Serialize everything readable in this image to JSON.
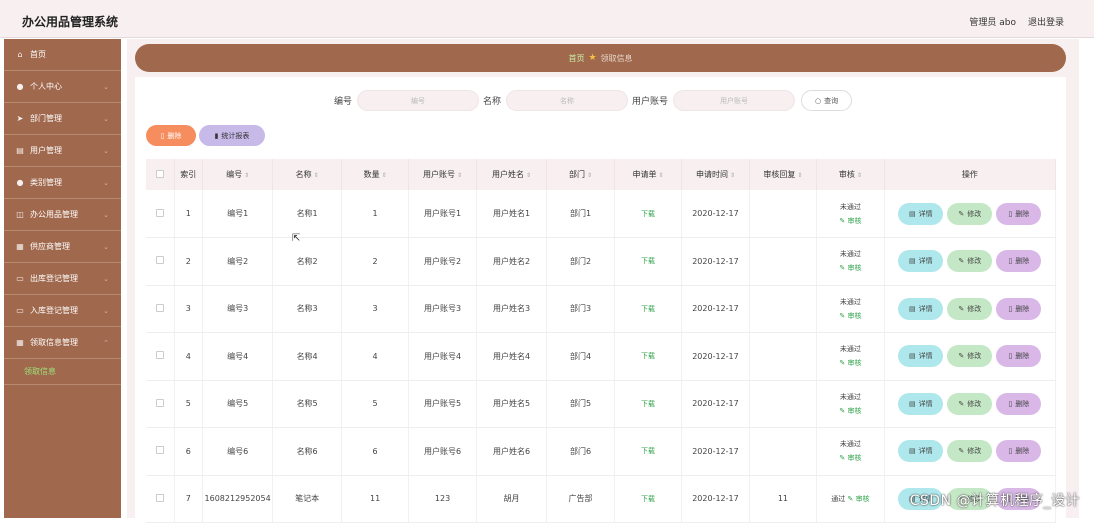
{
  "app": {
    "title": "办公用品管理系统"
  },
  "header": {
    "user": "管理员 abo",
    "logout": "退出登录"
  },
  "sidebar": {
    "items": [
      {
        "icon": "⌂",
        "label": "首页",
        "chev": ""
      },
      {
        "icon": "●",
        "label": "个人中心",
        "chev": "⌄"
      },
      {
        "icon": "➤",
        "label": "部门管理",
        "chev": "⌄"
      },
      {
        "icon": "▤",
        "label": "用户管理",
        "chev": "⌄"
      },
      {
        "icon": "●",
        "label": "类别管理",
        "chev": "⌄"
      },
      {
        "icon": "◫",
        "label": "办公用品管理",
        "chev": "⌄"
      },
      {
        "icon": "▦",
        "label": "供应商管理",
        "chev": "⌄"
      },
      {
        "icon": "▭",
        "label": "出库登记管理",
        "chev": "⌄"
      },
      {
        "icon": "▭",
        "label": "入库登记管理",
        "chev": "⌄"
      },
      {
        "icon": "▦",
        "label": "领取信息管理",
        "chev": "⌃"
      }
    ],
    "sub_item": "领取信息"
  },
  "breadcrumb": {
    "home": "首页",
    "star": "★",
    "current": "领取信息"
  },
  "search": {
    "f1_label": "编号",
    "f1_placeholder": "编号",
    "f2_label": "名称",
    "f2_placeholder": "名称",
    "f3_label": "用户账号",
    "f3_placeholder": "用户账号",
    "query": "查询"
  },
  "actions": {
    "delete": "删除",
    "stats": "统计报表"
  },
  "table": {
    "headers": [
      "索引",
      "编号",
      "名称",
      "数量",
      "用户账号",
      "用户姓名",
      "部门",
      "申请单",
      "申请时间",
      "审核回复",
      "审核",
      "操作"
    ],
    "rows": [
      [
        "1",
        "编号1",
        "名称1",
        "1",
        "用户账号1",
        "用户姓名1",
        "部门1",
        "下载",
        "2020-12-17",
        "",
        "未通过",
        "审核"
      ],
      [
        "2",
        "编号2",
        "名称2",
        "2",
        "用户账号2",
        "用户姓名2",
        "部门2",
        "下载",
        "2020-12-17",
        "",
        "未通过",
        "审核"
      ],
      [
        "3",
        "编号3",
        "名称3",
        "3",
        "用户账号3",
        "用户姓名3",
        "部门3",
        "下载",
        "2020-12-17",
        "",
        "未通过",
        "审核"
      ],
      [
        "4",
        "编号4",
        "名称4",
        "4",
        "用户账号4",
        "用户姓名4",
        "部门4",
        "下载",
        "2020-12-17",
        "",
        "未通过",
        "审核"
      ],
      [
        "5",
        "编号5",
        "名称5",
        "5",
        "用户账号5",
        "用户姓名5",
        "部门5",
        "下载",
        "2020-12-17",
        "",
        "未通过",
        "审核"
      ],
      [
        "6",
        "编号6",
        "名称6",
        "6",
        "用户账号6",
        "用户姓名6",
        "部门6",
        "下载",
        "2020-12-17",
        "",
        "未通过",
        "审核"
      ],
      [
        "7",
        "1608212952054",
        "笔记本",
        "11",
        "123",
        "胡月",
        "广告部",
        "下载",
        "2020-12-17",
        "11",
        "通过",
        "审核"
      ]
    ],
    "ops": {
      "detail": "详情",
      "edit": "修改",
      "delete": "删除"
    }
  },
  "watermark": "CSDN @计算机程序_设计",
  "colors": {
    "sidebar": "#a0684d",
    "background": "#f7eff0",
    "delete": "#f58d5e",
    "stats": "#c7b9e8",
    "detail": "#aee8ec",
    "edit": "#c4e8c5",
    "remove": "#d9b8e8",
    "download": "#2fa34a"
  }
}
